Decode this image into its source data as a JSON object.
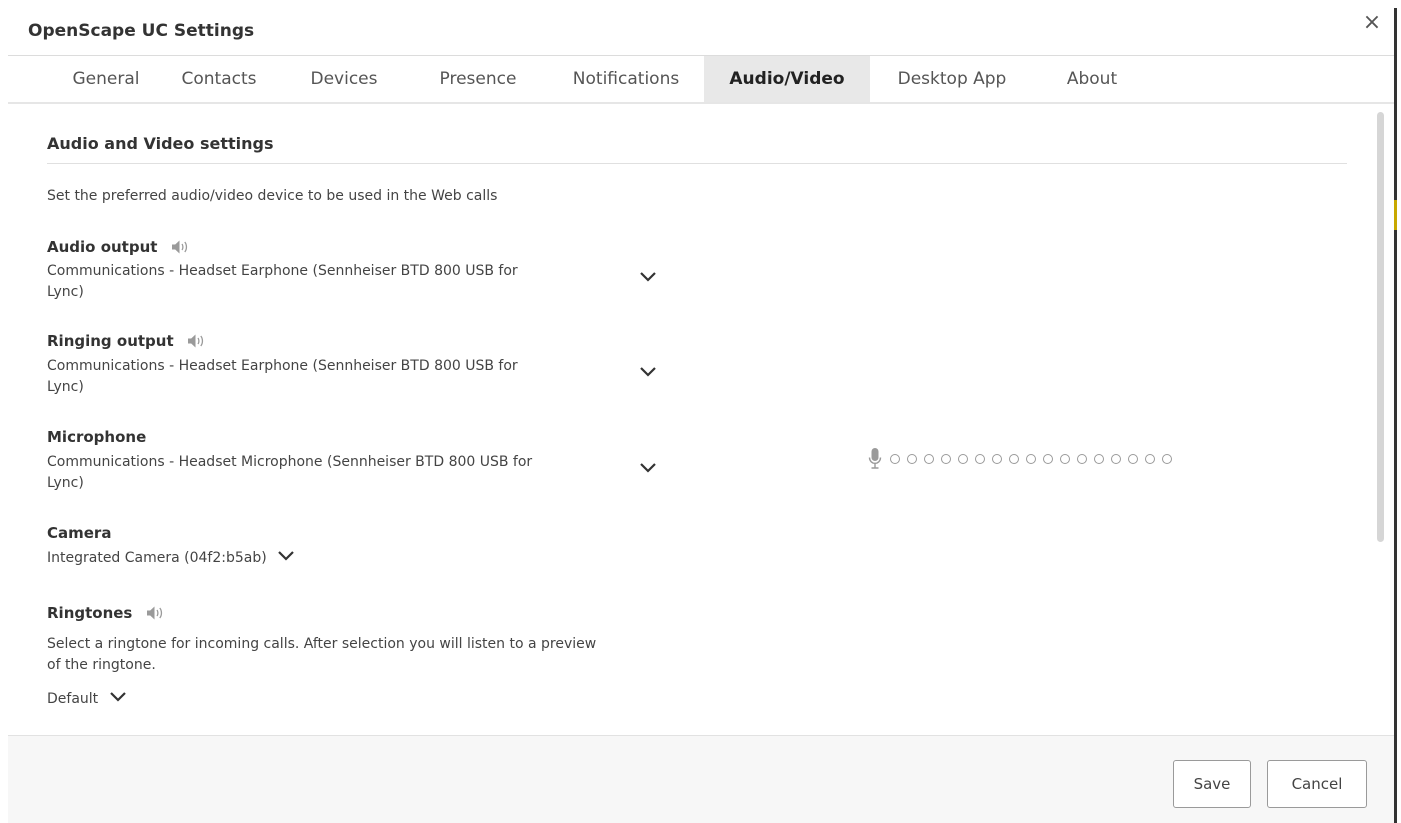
{
  "dialog": {
    "title": "OpenScape UC Settings",
    "close_glyph": "×"
  },
  "tabs": [
    {
      "label": "General",
      "active": false
    },
    {
      "label": "Contacts",
      "active": false
    },
    {
      "label": "Devices",
      "active": false
    },
    {
      "label": "Presence",
      "active": false
    },
    {
      "label": "Notifications",
      "active": false
    },
    {
      "label": "Audio/Video",
      "active": true
    },
    {
      "label": "Desktop App",
      "active": false
    },
    {
      "label": "About",
      "active": false
    }
  ],
  "content": {
    "section_title": "Audio and Video settings",
    "intro": "Set the preferred audio/video device to be used in the Web calls",
    "audio_output": {
      "label": "Audio output",
      "icon": "speaker-icon",
      "value_line1": "Communications - Headset Earphone (Sennheiser BTD 800 USB for",
      "value_line2": "Lync)"
    },
    "ringing_output": {
      "label": "Ringing output",
      "icon": "speaker-icon",
      "value_line1": "Communications - Headset Earphone (Sennheiser BTD 800 USB for",
      "value_line2": "Lync)"
    },
    "microphone": {
      "label": "Microphone",
      "value_line1": "Communications - Headset Microphone (Sennheiser BTD 800 USB for",
      "value_line2": "Lync)",
      "meter_icon": "microphone-icon",
      "meter_levels_total": 17,
      "meter_levels_active": 0
    },
    "camera": {
      "label": "Camera",
      "value": "Integrated Camera (04f2:b5ab)"
    },
    "ringtones": {
      "label": "Ringtones",
      "icon": "speaker-icon",
      "description_line1": "Select a ringtone for incoming calls. After selection you will listen to a preview",
      "description_line2": "of the ringtone.",
      "value": "Default"
    }
  },
  "footer": {
    "save_label": "Save",
    "cancel_label": "Cancel"
  },
  "colors": {
    "active_tab_bg": "#e8e8e8",
    "text": "#333333",
    "footer_bg": "#f7f7f7",
    "accent_edge": "#c8a800"
  }
}
